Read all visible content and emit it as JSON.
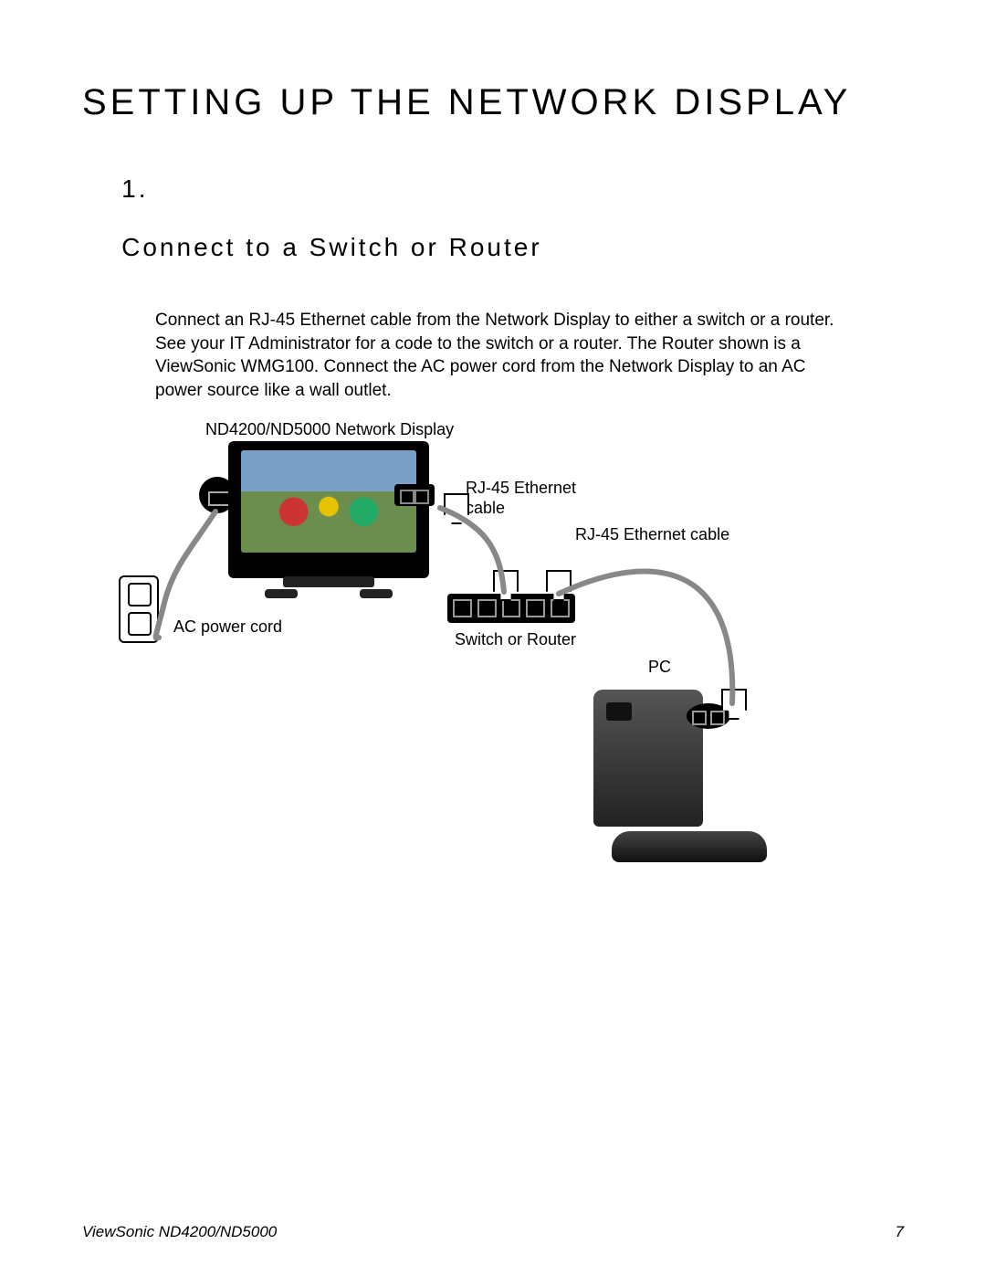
{
  "title": "SETTING UP THE NETWORK DISPLAY",
  "section": {
    "number": "1.",
    "heading": "Connect to a Switch or Router",
    "paragraph": "Connect an RJ-45 Ethernet cable from the Network Display to either a switch or a router. See your IT Administrator for a code to the switch or a router. The Router shown is a ViewSonic WMG100. Connect the AC power cord from the Network Display to an AC power source like a wall outlet."
  },
  "diagram_labels": {
    "display_model": "ND4200/ND5000 Network Display",
    "rj45_cable_1": "RJ-45 Ethernet\ncable",
    "rj45_cable_2": "RJ-45 Ethernet cable",
    "ac_power_cord": "AC power cord",
    "switch_router": "Switch or Router",
    "pc": "PC"
  },
  "footer": {
    "doc_title": "ViewSonic ND4200/ND5000",
    "page_number": "7"
  }
}
